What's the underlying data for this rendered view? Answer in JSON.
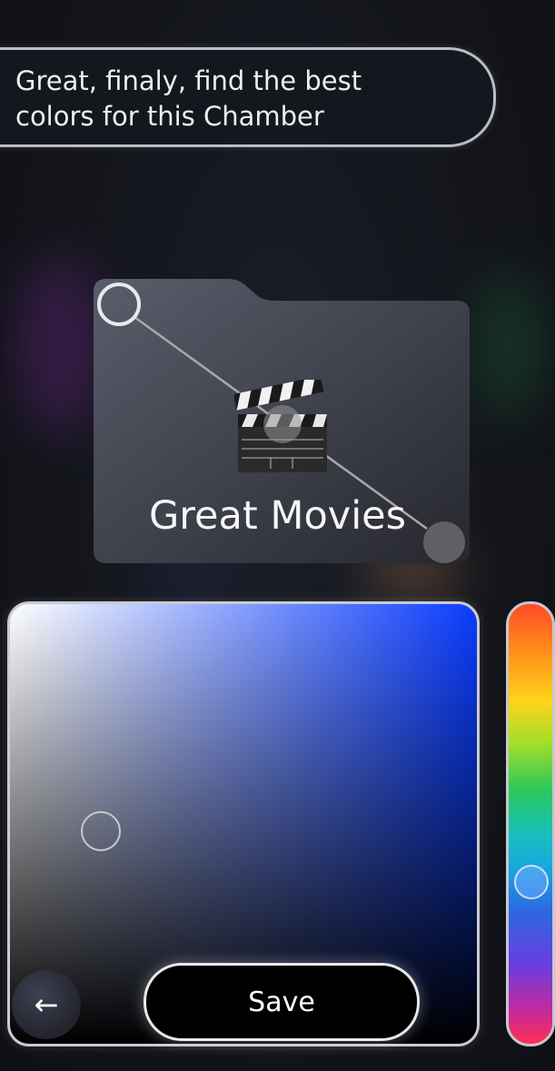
{
  "prompt": {
    "line1": "Great, finaly, find the best",
    "line2": "colors for this Chamber"
  },
  "folder": {
    "title": "Great Movies",
    "icon": "clapperboard-icon"
  },
  "color_picker": {
    "selected_hue": "#0a3cff"
  },
  "actions": {
    "save_label": "Save",
    "back_icon": "arrow-left-icon",
    "back_glyph": "←"
  }
}
